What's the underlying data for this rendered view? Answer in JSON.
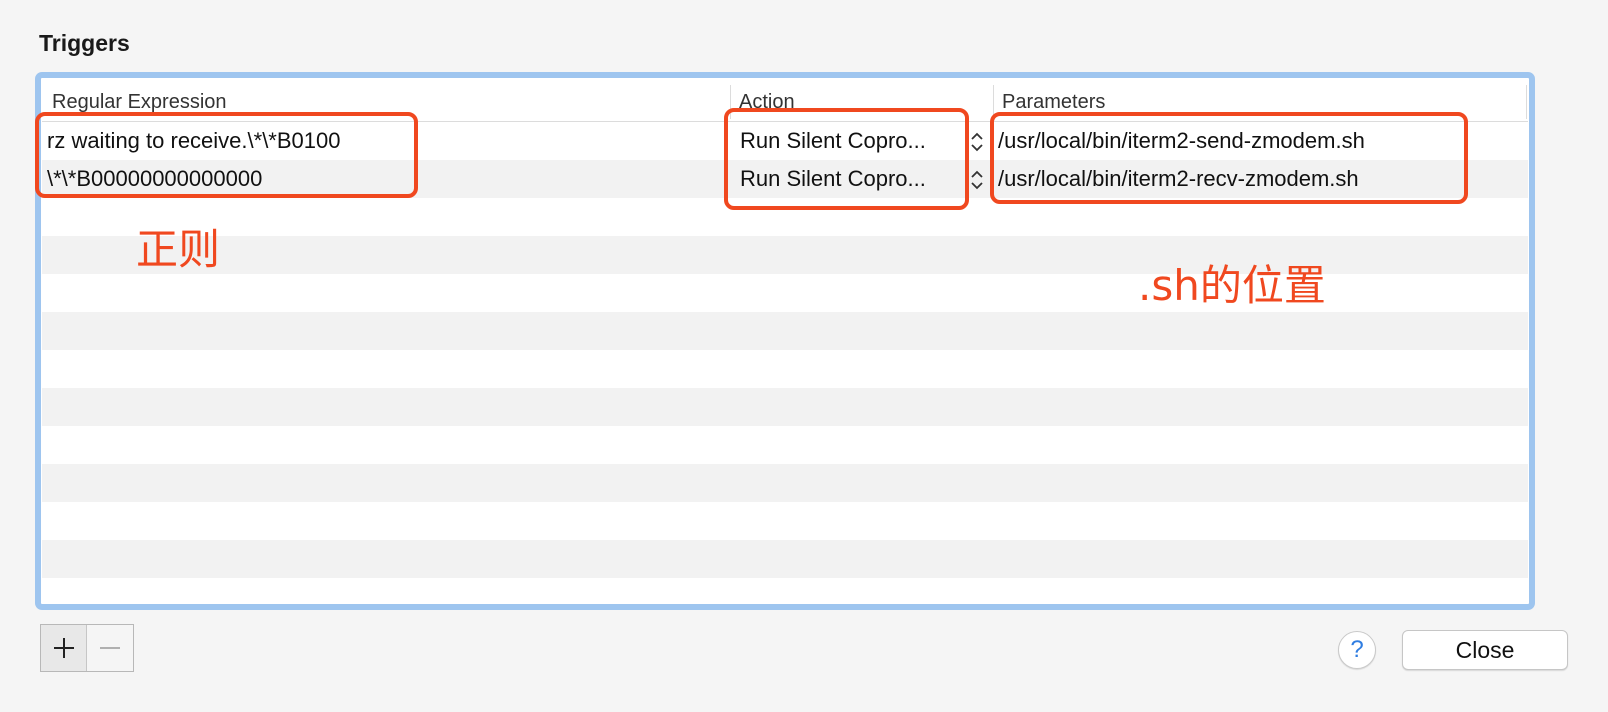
{
  "window": {
    "section_title": "Triggers"
  },
  "table": {
    "columns": [
      "Regular Expression",
      "Action",
      "Parameters"
    ],
    "rows": [
      {
        "regex": "rz waiting to receive.\\*\\*B0100",
        "action": "Run Silent Copro...",
        "parameters": "/usr/local/bin/iterm2-send-zmodem.sh"
      },
      {
        "regex": " \\*\\*B00000000000000",
        "action": "Run Silent Copro...",
        "parameters": "/usr/local/bin/iterm2-recv-zmodem.sh"
      }
    ],
    "empty_row_count": 11
  },
  "toolbar": {
    "add_icon": "plus-icon",
    "remove_icon": "minus-icon"
  },
  "footer": {
    "help_label": "?",
    "close_label": "Close"
  },
  "annotations": {
    "regex_label": "正则",
    "params_label": ".sh的位置",
    "color": "#f0481f"
  },
  "colors": {
    "focus_ring": "#9ec5ef",
    "alt_row": "#f2f2f2",
    "help_accent": "#2f7de1"
  }
}
